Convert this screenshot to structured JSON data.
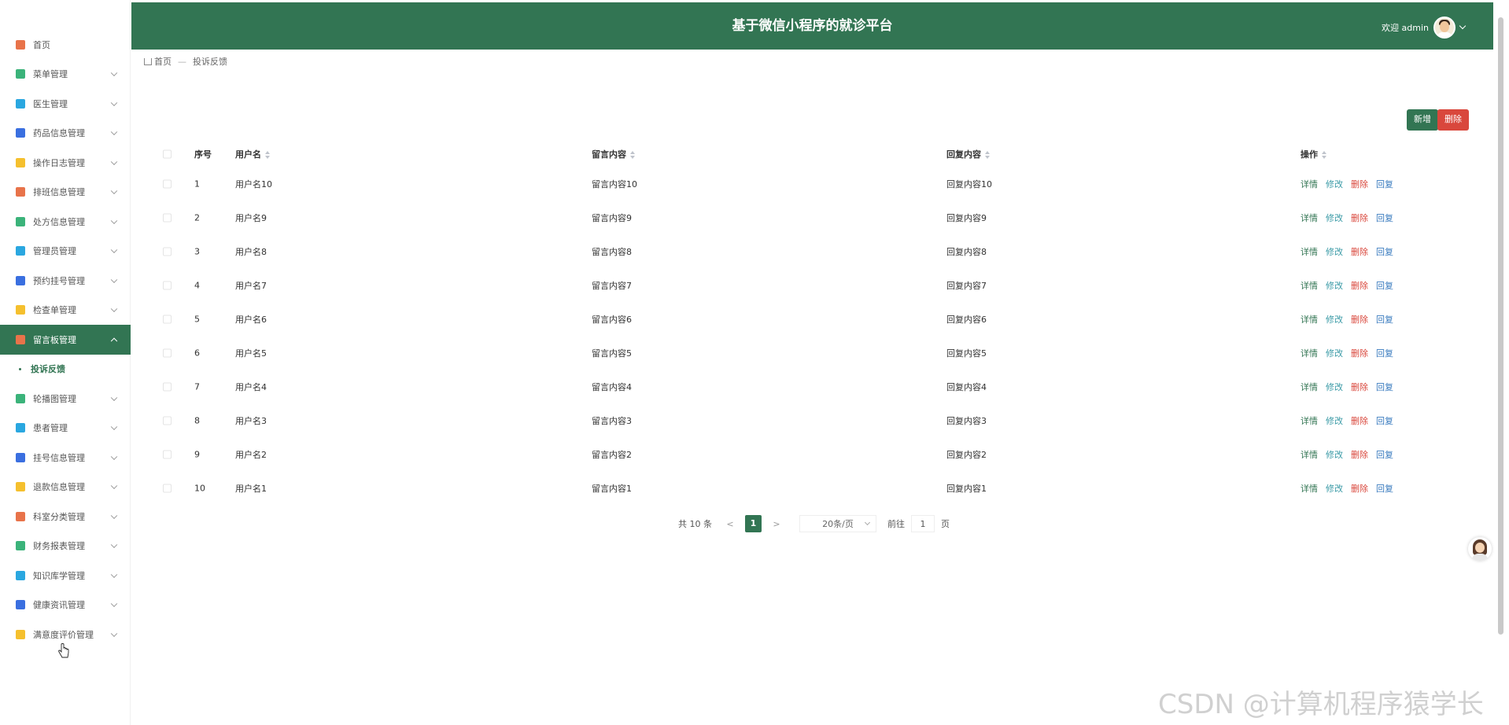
{
  "header": {
    "title": "基于微信小程序的就诊平台",
    "welcome": "欢迎 admin"
  },
  "sidebar": {
    "items": [
      {
        "label": "首页",
        "icon": "home-icon",
        "color": "#e8734a",
        "chevron": false
      },
      {
        "label": "菜单管理",
        "icon": "menu-icon",
        "color": "#3bb37a",
        "chevron": true
      },
      {
        "label": "医生管理",
        "icon": "doctor-icon",
        "color": "#2aa7e0",
        "chevron": true
      },
      {
        "label": "药品信息管理",
        "icon": "medicine-icon",
        "color": "#3a6fe0",
        "chevron": true
      },
      {
        "label": "操作日志管理",
        "icon": "folder-icon",
        "color": "#f5c02e",
        "chevron": true
      },
      {
        "label": "排班信息管理",
        "icon": "schedule-icon",
        "color": "#e8734a",
        "chevron": true
      },
      {
        "label": "处方信息管理",
        "icon": "prescription-icon",
        "color": "#3bb37a",
        "chevron": true
      },
      {
        "label": "管理员管理",
        "icon": "user-icon",
        "color": "#2aa7e0",
        "chevron": true
      },
      {
        "label": "预约挂号管理",
        "icon": "calendar-icon",
        "color": "#3a6fe0",
        "chevron": true
      },
      {
        "label": "检查单管理",
        "icon": "checklist-icon",
        "color": "#f5c02e",
        "chevron": true
      },
      {
        "label": "留言板管理",
        "icon": "message-icon",
        "color": "#e8734a",
        "chevron": true,
        "active": true
      },
      {
        "label": "投诉反馈",
        "sub": true
      },
      {
        "label": "轮播图管理",
        "icon": "carousel-icon",
        "color": "#3bb37a",
        "chevron": true
      },
      {
        "label": "患者管理",
        "icon": "patient-icon",
        "color": "#2aa7e0",
        "chevron": true
      },
      {
        "label": "挂号信息管理",
        "icon": "register-icon",
        "color": "#3a6fe0",
        "chevron": true
      },
      {
        "label": "退款信息管理",
        "icon": "refund-icon",
        "color": "#f5c02e",
        "chevron": true
      },
      {
        "label": "科室分类管理",
        "icon": "department-icon",
        "color": "#e8734a",
        "chevron": true
      },
      {
        "label": "财务报表管理",
        "icon": "finance-icon",
        "color": "#3bb37a",
        "chevron": true
      },
      {
        "label": "知识库学管理",
        "icon": "knowledge-icon",
        "color": "#2aa7e0",
        "chevron": true
      },
      {
        "label": "健康资讯管理",
        "icon": "news-icon",
        "color": "#3a6fe0",
        "chevron": true
      },
      {
        "label": "满意度评价管理",
        "icon": "rating-icon",
        "color": "#f5c02e",
        "chevron": true
      }
    ]
  },
  "breadcrumb": {
    "home": "首页",
    "current": "投诉反馈"
  },
  "toolbar": {
    "add_label": "新增",
    "delete_label": "删除"
  },
  "table": {
    "columns": [
      "序号",
      "用户名",
      "留言内容",
      "回复内容",
      "操作"
    ],
    "actions": [
      "详情",
      "修改",
      "删除",
      "回复"
    ],
    "rows": [
      {
        "index": "1",
        "username": "用户名10",
        "message": "留言内容10",
        "reply": "回复内容10"
      },
      {
        "index": "2",
        "username": "用户名9",
        "message": "留言内容9",
        "reply": "回复内容9"
      },
      {
        "index": "3",
        "username": "用户名8",
        "message": "留言内容8",
        "reply": "回复内容8"
      },
      {
        "index": "4",
        "username": "用户名7",
        "message": "留言内容7",
        "reply": "回复内容7"
      },
      {
        "index": "5",
        "username": "用户名6",
        "message": "留言内容6",
        "reply": "回复内容6"
      },
      {
        "index": "6",
        "username": "用户名5",
        "message": "留言内容5",
        "reply": "回复内容5"
      },
      {
        "index": "7",
        "username": "用户名4",
        "message": "留言内容4",
        "reply": "回复内容4"
      },
      {
        "index": "8",
        "username": "用户名3",
        "message": "留言内容3",
        "reply": "回复内容3"
      },
      {
        "index": "9",
        "username": "用户名2",
        "message": "留言内容2",
        "reply": "回复内容2"
      },
      {
        "index": "10",
        "username": "用户名1",
        "message": "留言内容1",
        "reply": "回复内容1"
      }
    ]
  },
  "pagination": {
    "total": "共 10 条",
    "prev": "<",
    "current_page": "1",
    "next": ">",
    "page_size": "20条/页",
    "goto_label": "前往",
    "goto_value": "1",
    "page_unit": "页"
  },
  "watermark": "CSDN @计算机程序猿学长",
  "colors": {
    "primary": "#327553",
    "danger": "#d9473c"
  }
}
